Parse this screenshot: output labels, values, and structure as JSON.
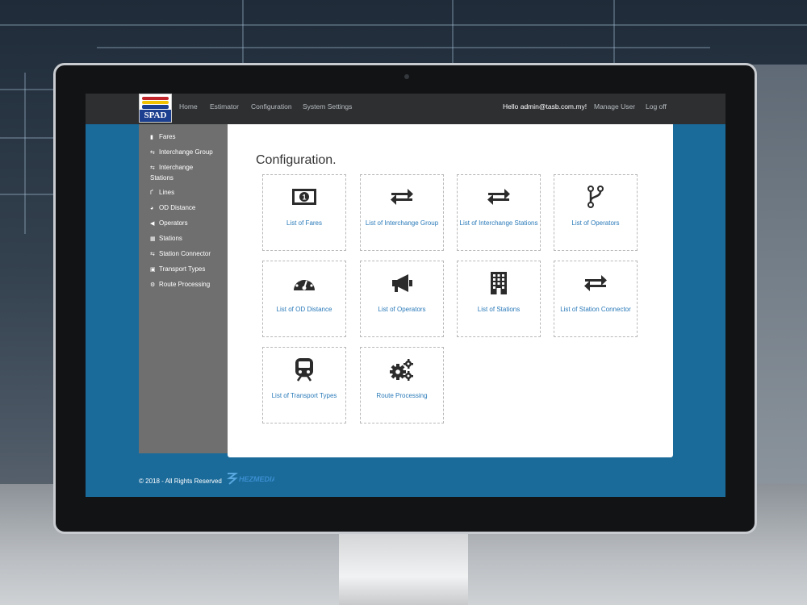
{
  "navbar": {
    "logo_text": "SPAD",
    "links": [
      "Home",
      "Estimator",
      "Configuration",
      "System Settings"
    ],
    "greeting": "Hello admin@tasb.com.my!",
    "manage_user": "Manage User",
    "logout": "Log off"
  },
  "sidebar": {
    "items": [
      {
        "label": "Fares",
        "icon": "money-icon"
      },
      {
        "label": "Interchange Group",
        "icon": "exchange-icon"
      },
      {
        "label": "Interchange Stations",
        "icon": "exchange-icon"
      },
      {
        "label": "Lines",
        "icon": "fork-icon"
      },
      {
        "label": "OD Distance",
        "icon": "dashboard-icon"
      },
      {
        "label": "Operators",
        "icon": "megaphone-icon"
      },
      {
        "label": "Stations",
        "icon": "building-icon"
      },
      {
        "label": "Station Connector",
        "icon": "exchange-icon"
      },
      {
        "label": "Transport Types",
        "icon": "train-icon"
      },
      {
        "label": "Route Processing",
        "icon": "gears-icon"
      }
    ]
  },
  "main": {
    "title": "Configuration.",
    "cards": [
      {
        "label": "List of Fares",
        "icon": "money-icon"
      },
      {
        "label": "List of Interchange Group",
        "icon": "exchange-icon"
      },
      {
        "label": "List of Interchange Stations",
        "icon": "exchange-icon"
      },
      {
        "label": "List of Operators",
        "icon": "fork-icon"
      },
      {
        "label": "List of OD Distance",
        "icon": "dashboard-icon"
      },
      {
        "label": "List of Operators",
        "icon": "megaphone-icon"
      },
      {
        "label": "List of Stations",
        "icon": "building-icon"
      },
      {
        "label": "List of Station Connector",
        "icon": "exchange-icon"
      },
      {
        "label": "List of Transport Types",
        "icon": "train-icon"
      },
      {
        "label": "Route Processing",
        "icon": "gears-icon"
      }
    ]
  },
  "footer": {
    "copyright": "© 2018 - All Rights Reserved",
    "brand": "HEZMEDIA"
  },
  "colors": {
    "navbar": "#2d2f31",
    "sidebar": "#6f6f6f",
    "page_bg": "#1a6a9a",
    "link": "#2a7ab9"
  }
}
